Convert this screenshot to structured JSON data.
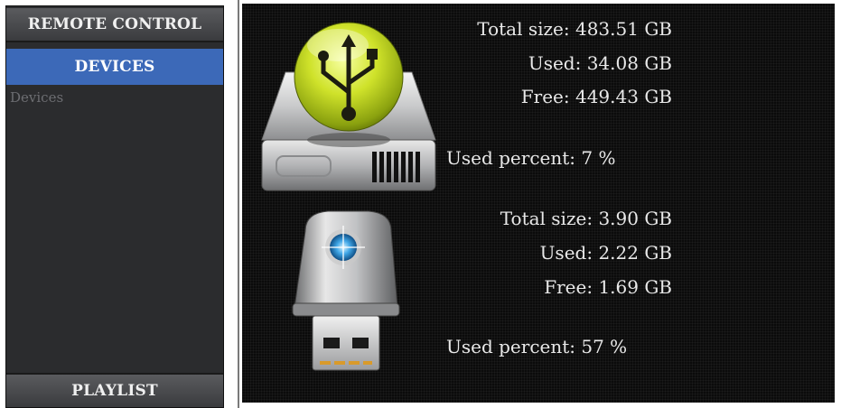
{
  "sidebar": {
    "remote_control_label": "REMOTE CONTROL",
    "devices_label": "DEVICES",
    "devices_list": [
      "Devices"
    ],
    "playlist_label": "PLAYLIST"
  },
  "devices": [
    {
      "icon": "usb-hard-drive-icon",
      "total_label": "Total size:",
      "total_value": "483.51 GB",
      "used_label": "Used:",
      "used_value": "34.08 GB",
      "free_label": "Free:",
      "free_value": "449.43 GB",
      "percent_label": "Used percent:",
      "percent_value": "7 %"
    },
    {
      "icon": "usb-flash-drive-icon",
      "total_label": "Total size:",
      "total_value": "3.90 GB",
      "used_label": "Used:",
      "used_value": "2.22 GB",
      "free_label": "Free:",
      "free_value": "1.69 GB",
      "percent_label": "Used percent:",
      "percent_value": "57 %"
    }
  ],
  "colors": {
    "accent": "#3c69b8",
    "panel_bg": "#0b0b0b",
    "sidebar_bg": "#2b2c2e",
    "text": "#e9e9e9"
  }
}
